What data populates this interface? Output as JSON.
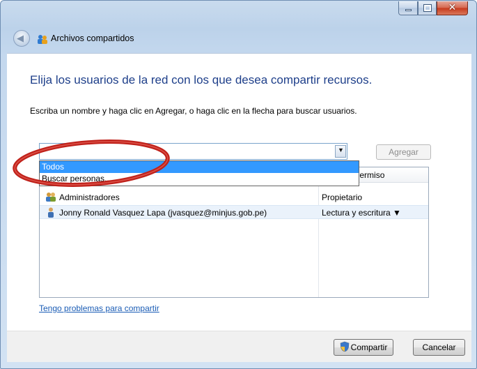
{
  "window": {
    "title": "Archivos compartidos",
    "caption_buttons": {
      "minimize": "minimize-icon",
      "maximize": "maximize-icon",
      "close": "close-icon"
    }
  },
  "content": {
    "heading": "Elija los usuarios de la red con los que desea compartir recursos.",
    "instructions": "Escriba un nombre y haga clic en Agregar, o haga clic en la flecha para buscar usuarios.",
    "name_input_value": "",
    "add_button_label": "Agregar",
    "dropdown_options": [
      "Todos",
      "Buscar personas..."
    ],
    "selected_option": "Todos",
    "table": {
      "permission_header": "Nivel de permiso",
      "rows": [
        {
          "name": "Administradores",
          "permission": "Propietario",
          "icon": "group-icon"
        },
        {
          "name": "Jonny Ronald Vasquez Lapa (jvasquez@minjus.gob.pe)",
          "permission": "Lectura y escritura ▼",
          "icon": "user-icon"
        }
      ]
    },
    "help_link": "Tengo problemas para compartir"
  },
  "footer": {
    "share_button": "Compartir",
    "cancel_button": "Cancelar"
  },
  "colors": {
    "heading": "#1e3f8a",
    "selection": "#3399ff",
    "annotation": "#c0221b"
  }
}
